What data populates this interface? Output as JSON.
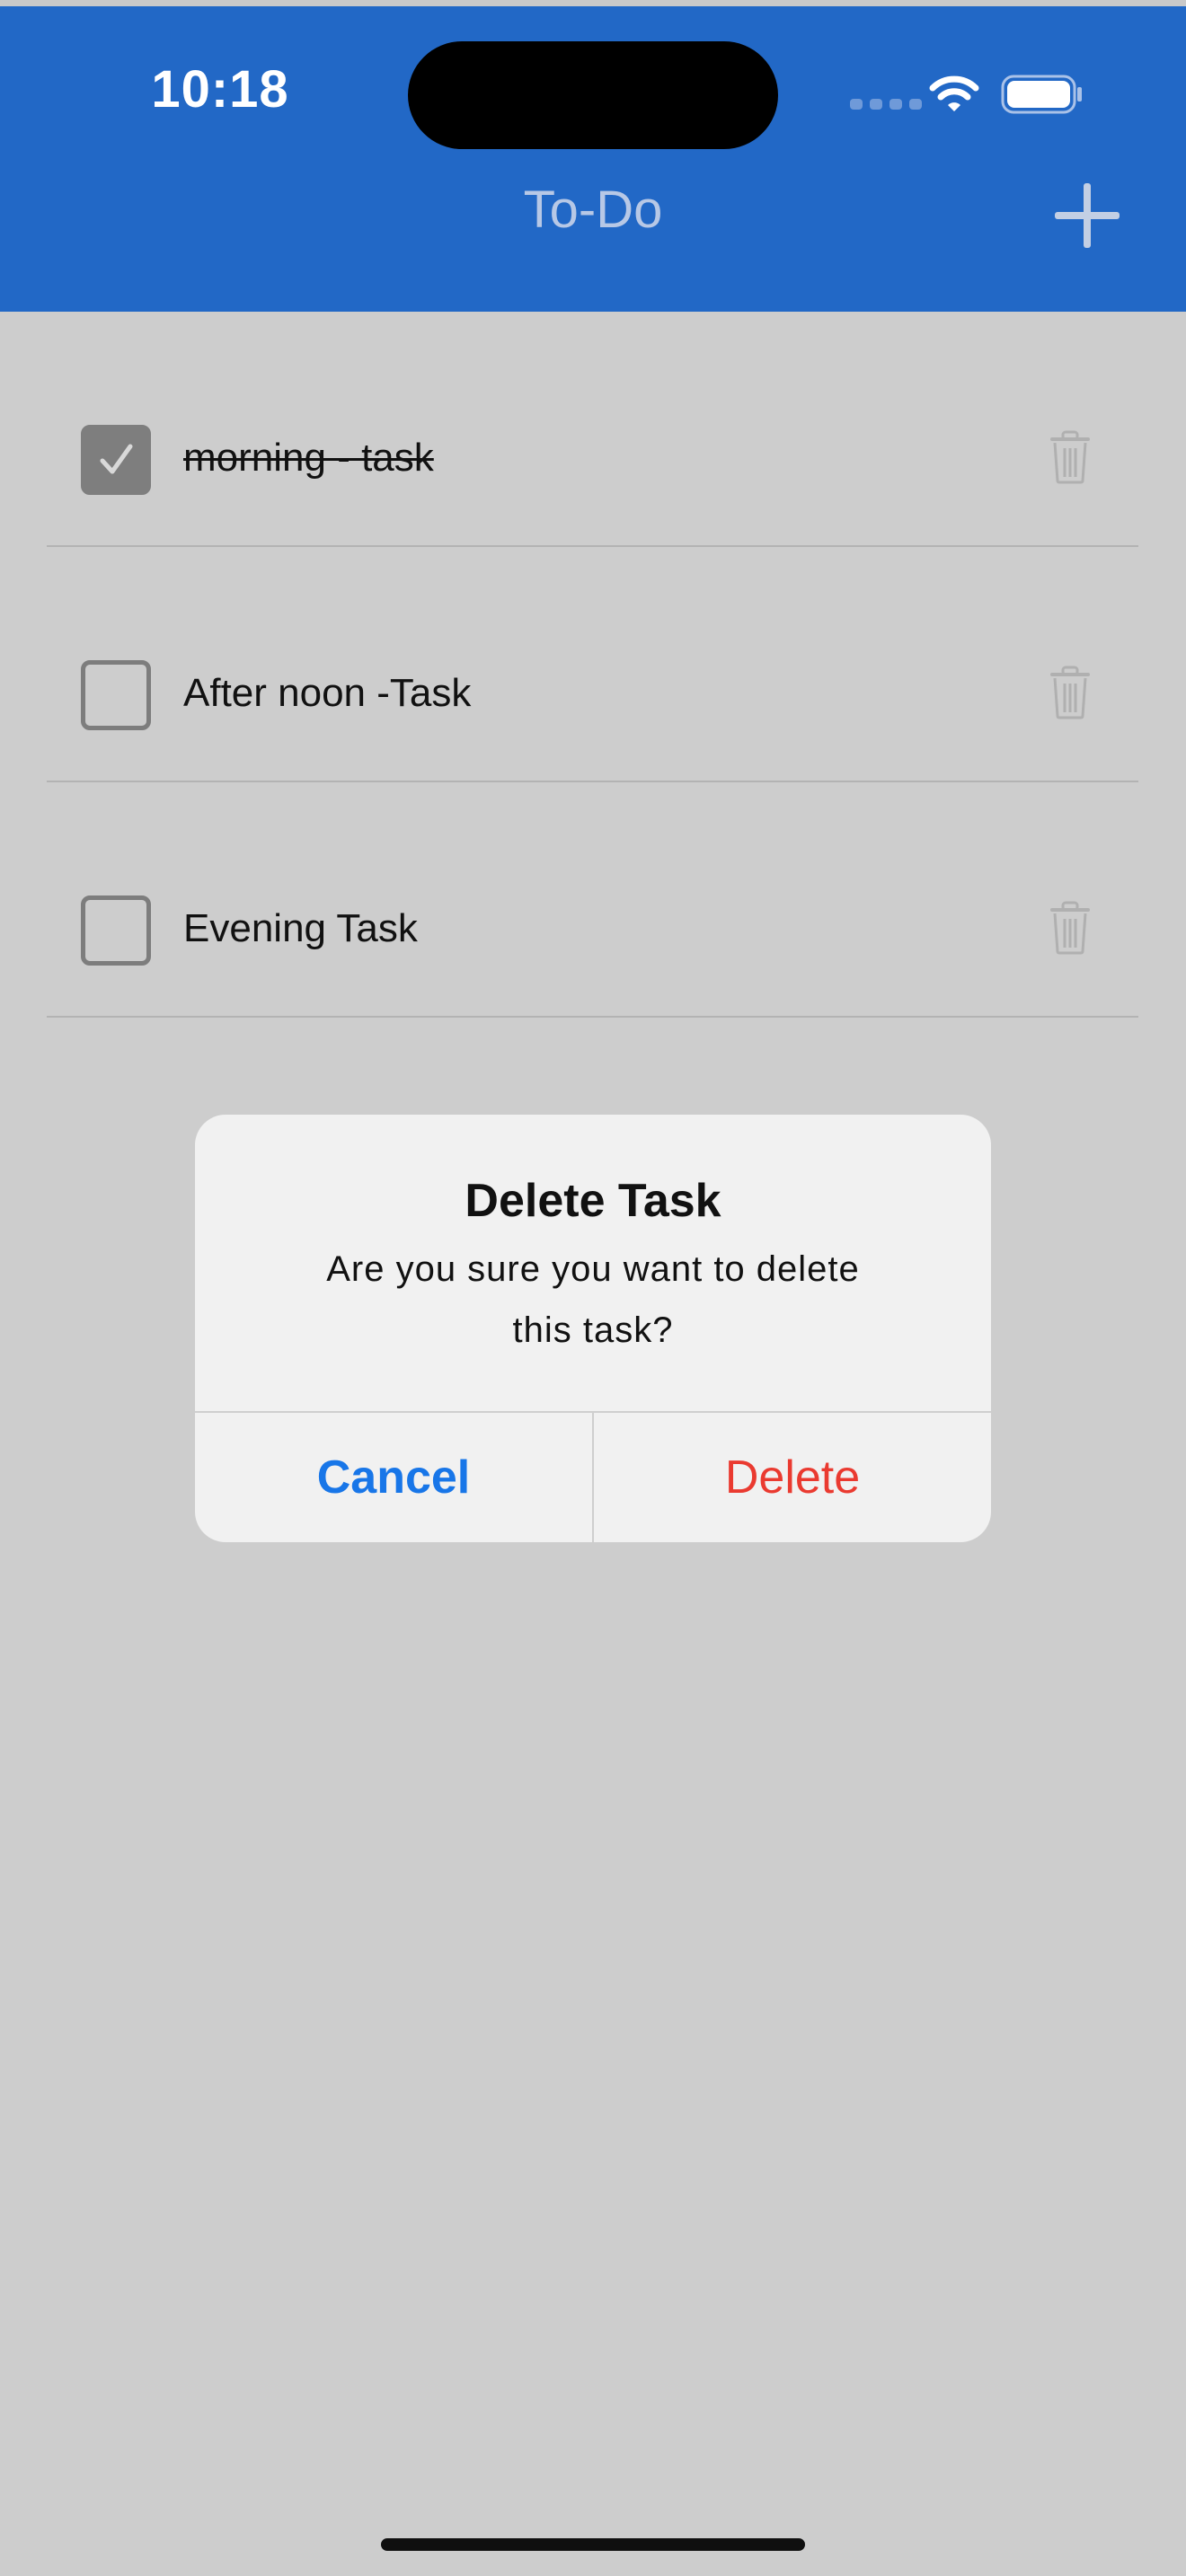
{
  "status_bar": {
    "time": "10:18",
    "icons": [
      "signal-icon",
      "wifi-icon",
      "battery-icon"
    ]
  },
  "nav": {
    "title": "To-Do",
    "add_icon": "plus-icon"
  },
  "tasks": [
    {
      "label": "morning - task",
      "completed": true
    },
    {
      "label": "After noon -Task",
      "completed": false
    },
    {
      "label": "Evening Task",
      "completed": false
    }
  ],
  "alert": {
    "title": "Delete Task",
    "message": "Are you sure you want to delete this task?",
    "cancel_label": "Cancel",
    "delete_label": "Delete"
  },
  "colors": {
    "header": "#2268c6",
    "background": "#cdcdcd",
    "cancel": "#1876e8",
    "delete": "#ea3a30"
  }
}
